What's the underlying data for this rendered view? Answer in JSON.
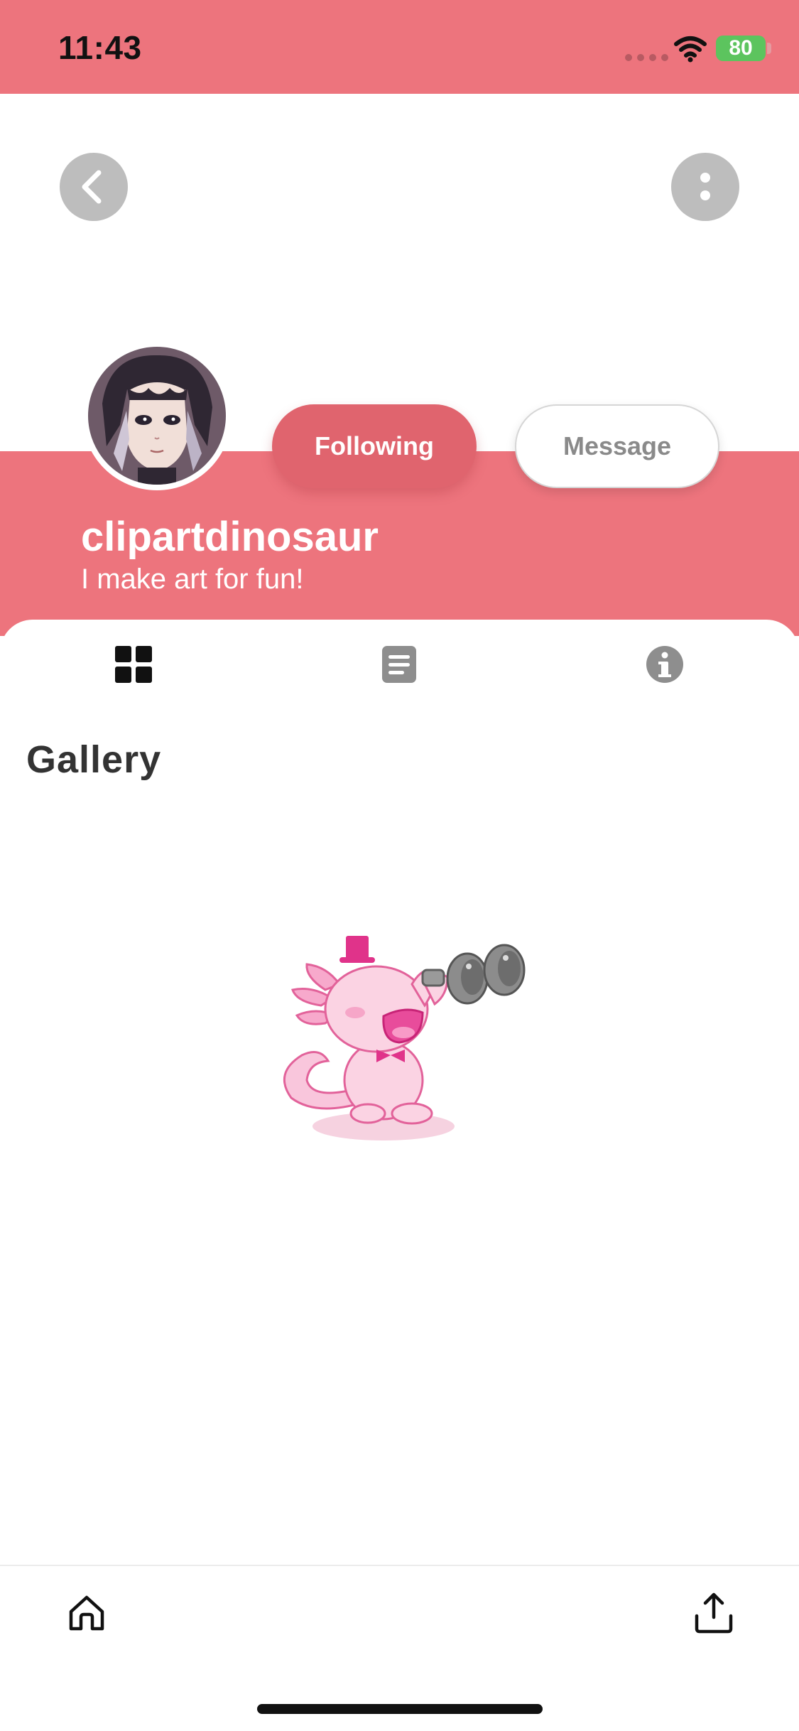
{
  "status_bar": {
    "time": "11:43",
    "battery": "80",
    "bar_color": "#ED747D"
  },
  "header": {
    "back_icon": "chevron-left-icon",
    "more_icon": "more-vertical-icon"
  },
  "profile": {
    "username": "clipartdinosaur",
    "bio": "I make art for fun!",
    "following_label": "Following",
    "message_label": "Message",
    "accent_color": "#ED747D"
  },
  "tabs": [
    {
      "icon": "grid-icon",
      "active": true
    },
    {
      "icon": "document-list-icon",
      "active": false
    },
    {
      "icon": "info-icon",
      "active": false
    }
  ],
  "gallery": {
    "title": "Gallery",
    "empty_illustration": "axolotl-binoculars-icon"
  },
  "bottom_bar": {
    "home_icon": "home-icon",
    "share_icon": "share-icon"
  }
}
